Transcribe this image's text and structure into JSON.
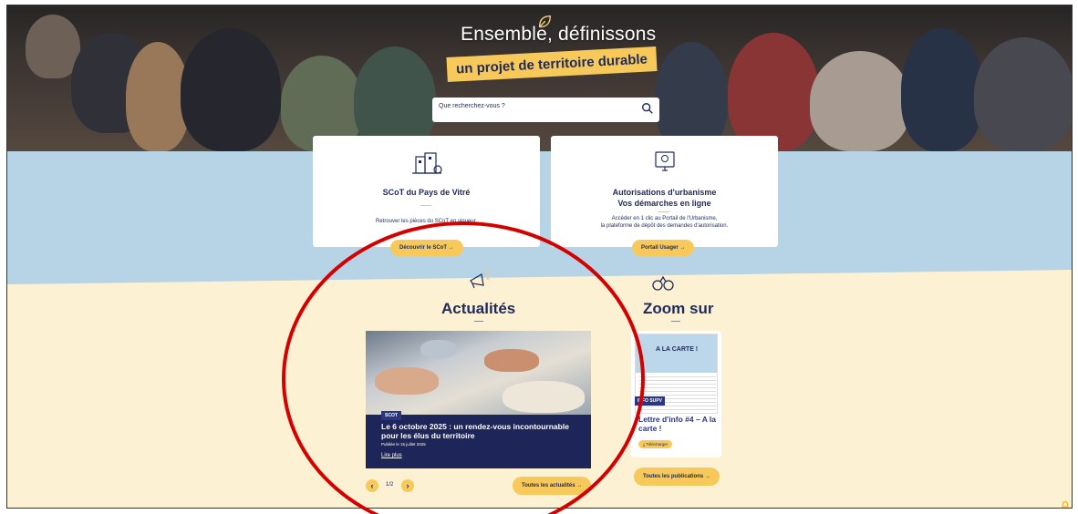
{
  "hero": {
    "title": "Ensemble, définissons",
    "subtitle": "un projet de territoire durable",
    "search_placeholder": "Que recherchez-vous ?"
  },
  "cards": [
    {
      "title_line1": "SCoT du Pays de Vitré",
      "title_line2": "",
      "desc_line1": "Retrouver les pièces du SCoT en vigueur.",
      "desc_line2": "",
      "button": "Découvrir le SCoT →"
    },
    {
      "title_line1": "Autorisations d'urbanisme",
      "title_line2": "Vos démarches en ligne",
      "desc_line1": "Accéder en 1 clic au Portail de l'Urbanisme,",
      "desc_line2": "la plateforme de dépôt des demandes d'autorisation.",
      "button": "Portail Usager →"
    }
  ],
  "news": {
    "section_title": "Actualités",
    "tag": "SCOT",
    "title": "Le 6 octobre 2025 : un rendez-vous incontournable pour les élus du territoire",
    "date": "Publiée le 15 juillet 2025",
    "read_more": "Lire plus",
    "pager": "1/2",
    "all_button": "Toutes les actualités →"
  },
  "zoom": {
    "section_title": "Zoom sur",
    "doc_title": "A LA CARTE !",
    "info_tag": "INFO SUPV",
    "title": "Lettre d'info #4 – A la carte !",
    "download": "Télécharger",
    "all_button": "Toutes les publications →"
  },
  "colors": {
    "navy": "#1f2a5c",
    "yellow": "#f7c95b",
    "blue_band": "#b7d3e6",
    "cream": "#fdf1d4",
    "annotation_red": "#d40000"
  }
}
